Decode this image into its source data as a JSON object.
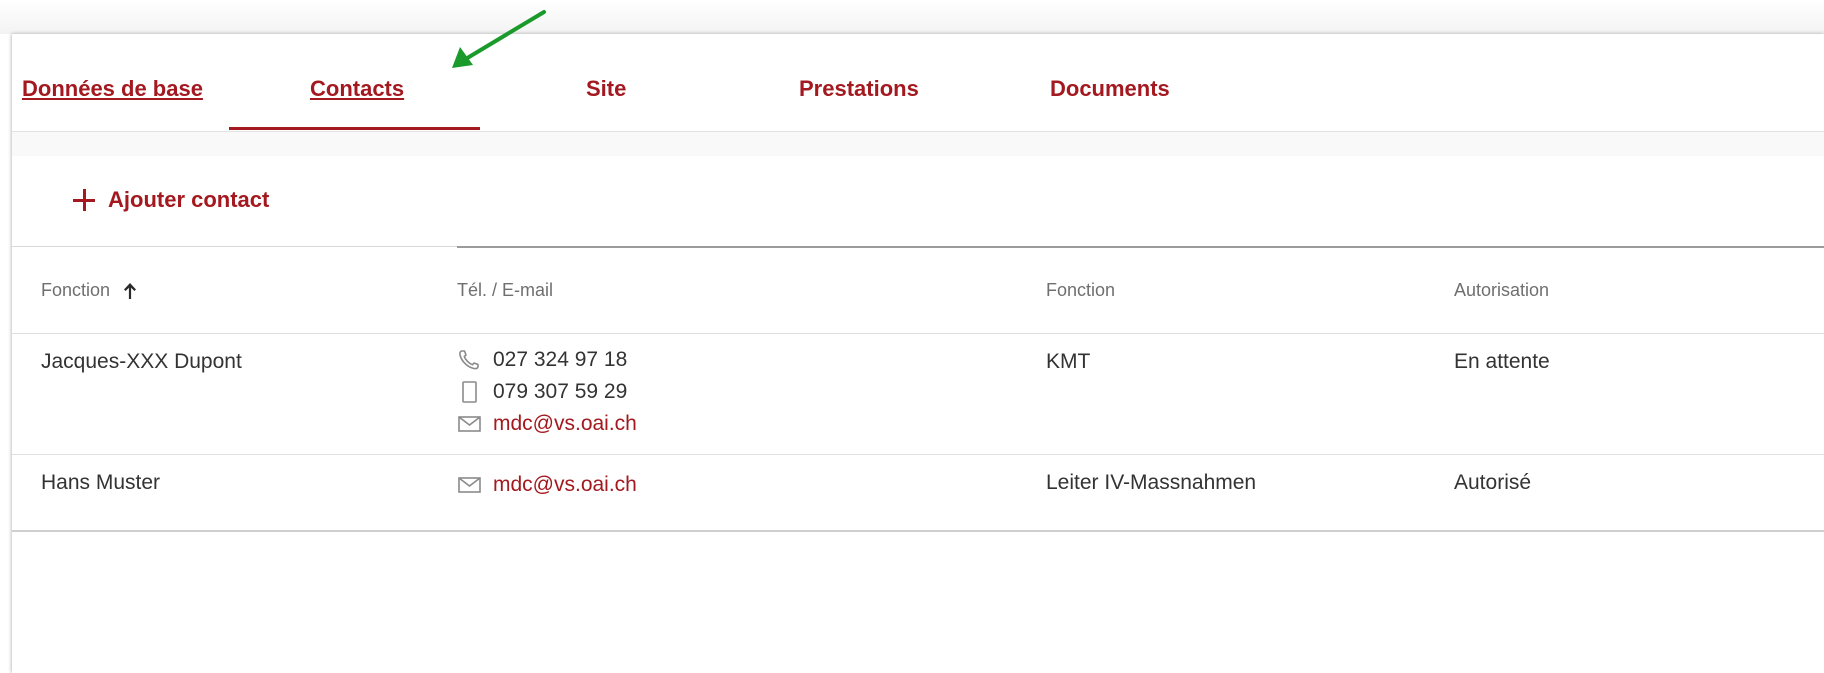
{
  "tabs": [
    {
      "label": "Données de base"
    },
    {
      "label": "Contacts"
    },
    {
      "label": "Site"
    },
    {
      "label": "Prestations"
    },
    {
      "label": "Documents"
    }
  ],
  "active_tab": "Contacts",
  "toolbar": {
    "add_contact_label": "Ajouter contact"
  },
  "table": {
    "columns": [
      "Fonction",
      "Tél. / E-mail",
      "Fonction",
      "Autorisation"
    ],
    "sorted_column": "Fonction",
    "sort_direction": "ascending",
    "rows": [
      {
        "name": "Jacques-XXX Dupont",
        "phone": "027 324 97 18",
        "mobile": "079 307 59 29",
        "email": "mdc@vs.oai.ch",
        "fonction": "KMT",
        "autorisation": "En attente"
      },
      {
        "name": "Hans Muster",
        "email": "mdc@vs.oai.ch",
        "fonction": "Leiter IV-Massnahmen",
        "autorisation": "Autorisé"
      }
    ]
  },
  "icons": {
    "add": "plus-icon",
    "sort": "arrow-up-icon",
    "phone": "phone-icon",
    "mobile": "mobile-phone-icon",
    "email": "envelope-icon"
  },
  "colors": {
    "accent": "#a3191f",
    "annotation_arrow": "#1a9a2a",
    "header_text": "#6f6f6f",
    "body_text": "#333333"
  }
}
